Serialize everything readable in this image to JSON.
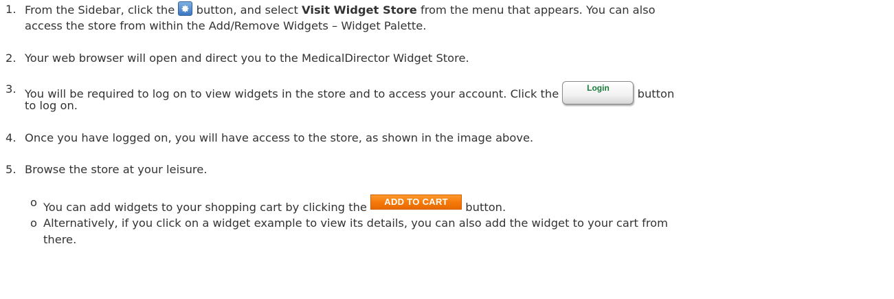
{
  "steps": [
    {
      "number": "1.",
      "line1_a": "From the Sidebar, click the",
      "line1_b": "button, and select",
      "line1_bold": "Visit Widget Store",
      "line1_c": "from the menu that appears. You can also",
      "line2": "access the store from within the Add/Remove Widgets – Widget Palette."
    },
    {
      "number": "2.",
      "text": "Your web browser will open and direct you to the MedicalDirector Widget Store."
    },
    {
      "number": "3.",
      "line1_a": "You will be required to log on to view widgets in the store and to access your account. Click the",
      "line1_b": "button",
      "line2": "to log on."
    },
    {
      "number": "4.",
      "text": "Once you have logged on, you will have access to the store, as shown in the image above."
    },
    {
      "number": "5.",
      "text": "Browse the store at your leisure."
    }
  ],
  "sub_items": [
    {
      "bullet": "o",
      "text_a": "You can add widgets to your shopping cart by clicking the",
      "text_b": "button."
    },
    {
      "bullet": "o",
      "line1": "Alternatively, if you click on a widget example to view its details, you can also add the widget to your cart from",
      "line2": "there."
    }
  ],
  "buttons": {
    "login_label": "Login",
    "add_to_cart_label": "ADD TO CART"
  },
  "icons": {
    "sidebar_button": "gear-icon"
  },
  "colors": {
    "text": "#333333",
    "login_text": "#1a7a3a",
    "cart_orange": "#f57a0a",
    "gear_blue": "#3d78c2"
  }
}
